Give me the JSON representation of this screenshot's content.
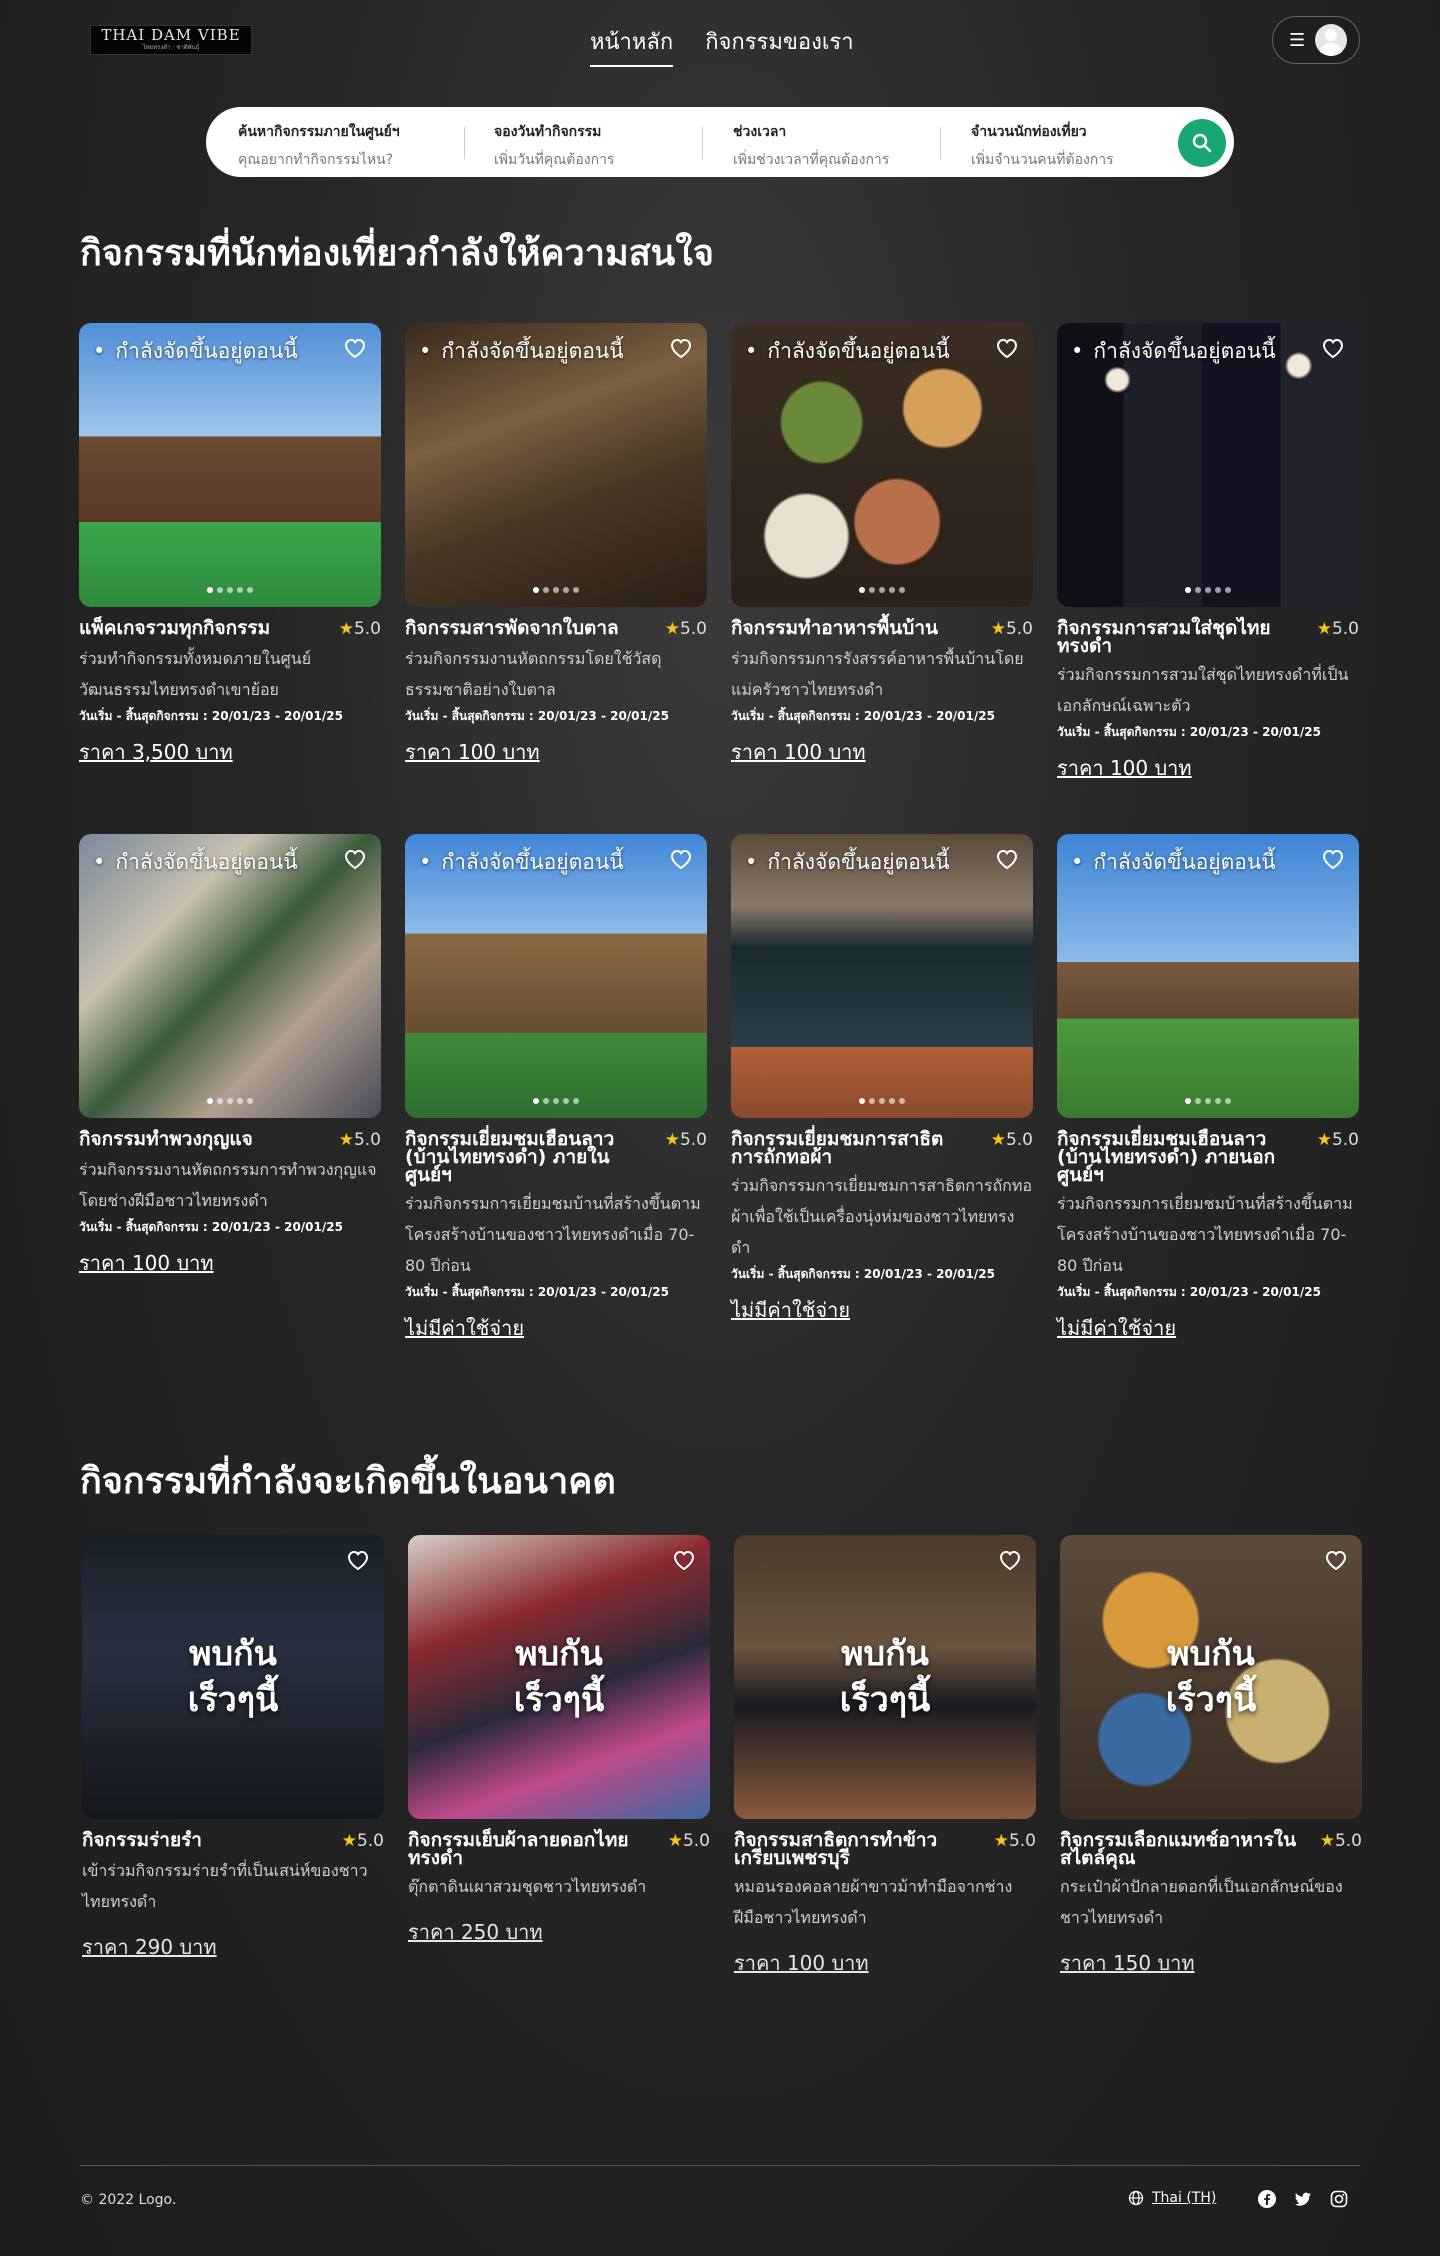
{
  "brand": {
    "logo_text": "THAI DAM VIBE",
    "logo_sub": "ไทยทรงดำ · ชาติพันธุ์"
  },
  "nav": {
    "links": [
      {
        "label": "หน้าหลัก"
      },
      {
        "label": "กิจกรรมของเรา"
      }
    ],
    "menu_icon": "hamburger-icon",
    "avatar_icon": "user-avatar-icon"
  },
  "search": {
    "fields": [
      {
        "label": "ค้นหากิจกรรมภายในศูนย์ฯ",
        "placeholder": "คุณอยากทำกิจกรรมไหน?"
      },
      {
        "label": "จองวันทำกิจกรรม",
        "placeholder": "เพิ่มวันที่คุณต้องการ"
      },
      {
        "label": "ช่วงเวลา",
        "placeholder": "เพิ่มช่วงเวลาที่คุณต้องการ"
      },
      {
        "label": "จำนวนนักท่องเที่ยว",
        "placeholder": "เพิ่มจำนวนคนที่ต้องการ"
      }
    ],
    "button_icon": "search-icon",
    "button_color": "#18a673"
  },
  "popular": {
    "title": "กิจกรรมที่นักท่องเที่ยวกำลังให้ความสนใจ",
    "badge": "กำลังจัดขึ้นอยู่ตอนนี้",
    "cards": [
      {
        "title": "แพ็คเกจรวมทุกกิจกรรม",
        "rating": "5.0",
        "desc": "ร่วมทำกิจกรรมทั้งหมดภายในศูนย์วัฒนธรรมไทยทรงดำเขาย้อย",
        "dates": "วันเริ่ม - สิ้นสุดกิจกรรม : 20/01/23 - 20/01/25",
        "price": "ราคา 3,500 บาท"
      },
      {
        "title": "กิจกรรมสารพัดจากใบตาล",
        "rating": "5.0",
        "desc": "ร่วมกิจกรรมงานหัตถกรรมโดยใช้วัสดุธรรมชาติอย่างใบตาล",
        "dates": "วันเริ่ม - สิ้นสุดกิจกรรม : 20/01/23 - 20/01/25",
        "price": "ราคา 100 บาท"
      },
      {
        "title": "กิจกรรมทำอาหารพื้นบ้าน",
        "rating": "5.0",
        "desc": "ร่วมกิจกรรมการรังสรรค์อาหารพื้นบ้านโดยแม่ครัวชาวไทยทรงดำ",
        "dates": "วันเริ่ม - สิ้นสุดกิจกรรม : 20/01/23 - 20/01/25",
        "price": "ราคา 100 บาท"
      },
      {
        "title": "กิจกรรมการสวมใส่ชุดไทยทรงดำ",
        "rating": "5.0",
        "desc": "ร่วมกิจกรรมการสวมใส่ชุดไทยทรงดำที่เป็นเอกลักษณ์เฉพาะตัว",
        "dates": "วันเริ่ม - สิ้นสุดกิจกรรม : 20/01/23 - 20/01/25",
        "price": "ราคา 100 บาท"
      },
      {
        "title": "กิจกรรมทำพวงกุญแจ",
        "rating": "5.0",
        "desc": "ร่วมกิจกรรมงานหัตถกรรมการทำพวงกุญแจโดยช่างฝีมือชาวไทยทรงดำ",
        "dates": "วันเริ่ม - สิ้นสุดกิจกรรม : 20/01/23 - 20/01/25",
        "price": "ราคา 100 บาท"
      },
      {
        "title": "กิจกรรมเยี่ยมชมเฮือนลาว (บ้านไทยทรงดำ) ภายในศูนย์ฯ",
        "rating": "5.0",
        "desc": "ร่วมกิจกรรมการเยี่ยมชมบ้านที่สร้างขึ้นตามโครงสร้างบ้านของชาวไทยทรงดำเมื่อ 70-80 ปีก่อน",
        "dates": "วันเริ่ม - สิ้นสุดกิจกรรม : 20/01/23 - 20/01/25",
        "price": "ไม่มีค่าใช้จ่าย"
      },
      {
        "title": "กิจกรรมเยี่ยมชมการสาธิตการถักทอผ้า",
        "rating": "5.0",
        "desc": "ร่วมกิจกรรมการเยี่ยมชมการสาธิตการถักทอผ้าเพื่อใช้เป็นเครื่องนุ่งห่มของชาวไทยทรงดำ",
        "dates": "วันเริ่ม - สิ้นสุดกิจกรรม : 20/01/23 - 20/01/25",
        "price": "ไม่มีค่าใช้จ่าย"
      },
      {
        "title": "กิจกรรมเยี่ยมชมเฮือนลาว (บ้านไทยทรงดำ) ภายนอกศูนย์ฯ",
        "rating": "5.0",
        "desc": "ร่วมกิจกรรมการเยี่ยมชมบ้านที่สร้างขึ้นตามโครงสร้างบ้านของชาวไทยทรงดำเมื่อ 70-80 ปีก่อน",
        "dates": "วันเริ่ม - สิ้นสุดกิจกรรม : 20/01/23 - 20/01/25",
        "price": "ไม่มีค่าใช้จ่าย"
      }
    ]
  },
  "upcoming": {
    "title": "กิจกรรมที่กำลังจะเกิดขึ้นในอนาคต",
    "overlay": "พบกัน เร็วๆนี้",
    "cards": [
      {
        "title": "กิจกรรมร่ายรำ",
        "rating": "5.0",
        "desc": "เข้าร่วมกิจกรรมร่ายรำที่เป็นเสน่ห์ของชาวไทยทรงดำ",
        "price": "ราคา 290 บาท"
      },
      {
        "title": "กิจกรรมเย็บผ้าลายดอกไทยทรงดำ",
        "rating": "5.0",
        "desc": "ตุ๊กตาดินเผาสวมชุดชาวไทยทรงดำ",
        "price": "ราคา 250 บาท"
      },
      {
        "title": "กิจกรรมสาธิตการทำข้าวเกรียบเพชรบุรี",
        "rating": "5.0",
        "desc": "หมอนรองคอลายผ้าขาวม้าทำมือจากช่างฝีมือชาวไทยทรงดำ",
        "price": "ราคา 100 บาท"
      },
      {
        "title": "กิจกรรมเลือกแมทช์อาหารในสไตล์คุณ",
        "rating": "5.0",
        "desc": "กระเป๋าผ้าปักลายดอกที่เป็นเอกลักษณ์ของชาวไทยทรงดำ",
        "price": "ราคา 150 บาท"
      }
    ]
  },
  "footer": {
    "copyright": "© 2022 Logo.",
    "language": "Thai (TH)",
    "language_icon": "globe-icon",
    "social_icons": [
      "facebook-icon",
      "twitter-icon",
      "instagram-icon"
    ]
  }
}
